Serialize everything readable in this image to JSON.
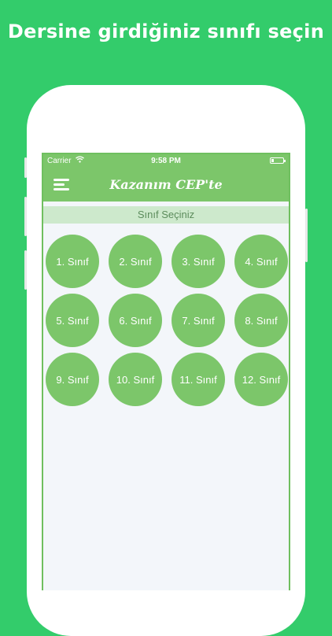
{
  "headline": "Dersine girdiğiniz sınıfı seçin",
  "status_bar": {
    "carrier": "Carrier",
    "wifi_icon": "wifi-icon",
    "time": "9:58 PM",
    "battery_icon": "battery-icon"
  },
  "nav": {
    "title": "Kazanım CEP'te",
    "menu_icon": "hamburger-menu-icon"
  },
  "section": {
    "title": "Sınıf Seçiniz"
  },
  "classes": [
    "1. Sınıf",
    "2. Sınıf",
    "3. Sınıf",
    "4. Sınıf",
    "5. Sınıf",
    "6. Sınıf",
    "7. Sınıf",
    "8. Sınıf",
    "9. Sınıf",
    "10. Sınıf",
    "11. Sınıf",
    "12. Sınıf"
  ],
  "colors": {
    "background": "#33cc6b",
    "accent": "#7cc66a",
    "section_bg": "#cde9cc",
    "screen_bg": "#f3f6fa"
  }
}
